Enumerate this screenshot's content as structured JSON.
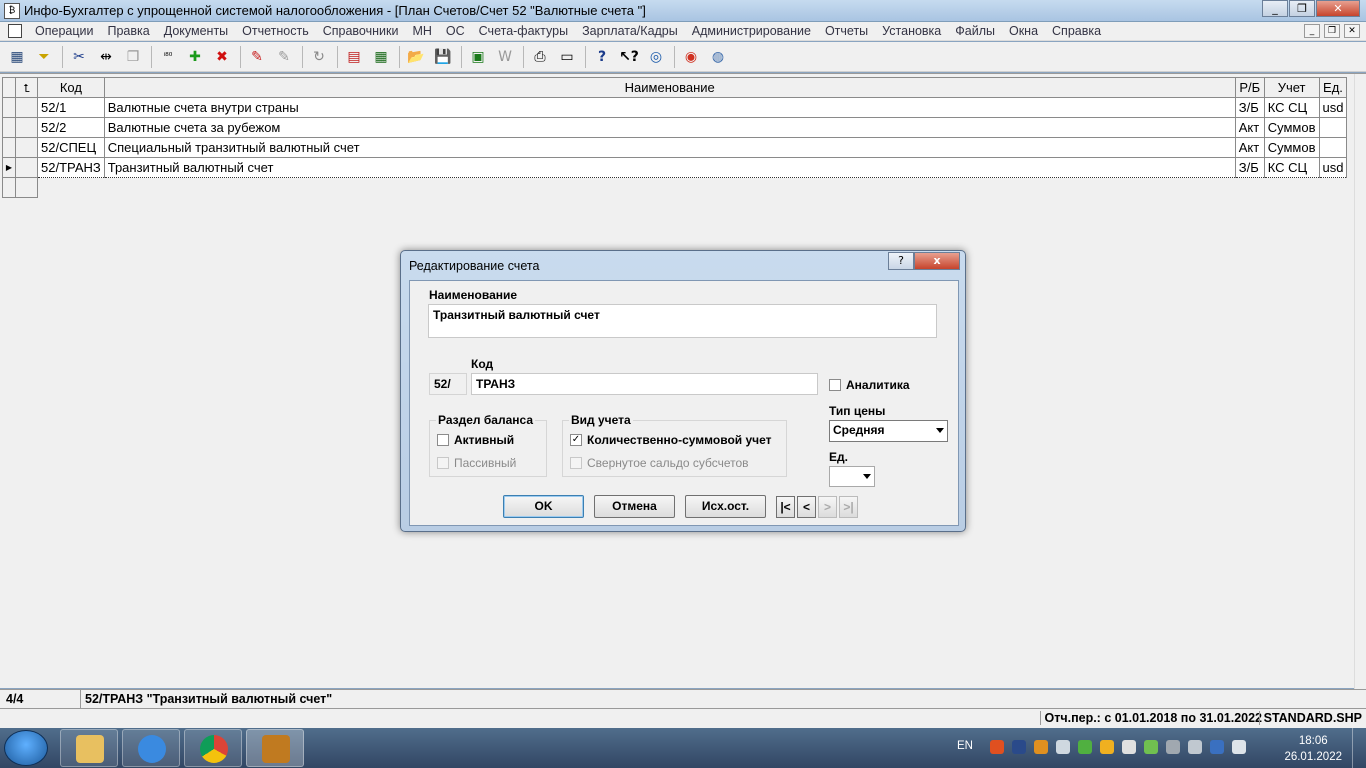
{
  "window": {
    "title": "Инфо-Бухгалтер с упрощенной системой налогообложения - [План Счетов/Счет 52 \"Валютные счета \"]"
  },
  "menu": [
    "Операции",
    "Правка",
    "Документы",
    "Отчетность",
    "Справочники",
    "МН",
    "ОС",
    "Счета-фактуры",
    "Зарплата/Кадры",
    "Администрирование",
    "Отчеты",
    "Установка",
    "Файлы",
    "Окна",
    "Справка"
  ],
  "toolbar_icons": [
    "table-icon",
    "filter-icon",
    "cut-icon",
    "split-icon",
    "copy-icon",
    "counter-icon",
    "add-icon",
    "delete-icon",
    "marker-icon",
    "unmark-icon",
    "refresh-icon",
    "document-icon",
    "calculator-icon",
    "open-folder-icon",
    "save-icon",
    "excel-icon",
    "word-icon",
    "print-icon",
    "preview-icon",
    "help-icon",
    "context-help-icon",
    "compass-icon",
    "support-icon",
    "web-icon"
  ],
  "grid": {
    "headers": {
      "code": "Код",
      "name": "Наименование",
      "rb": "Р/Б",
      "uchet": "Учет",
      "ed": "Ед."
    },
    "rows": [
      {
        "code": "52/1",
        "name": "Валютные счета внутри страны",
        "rb": "З/Б",
        "uchet": "КС СЦ",
        "ed": "usd"
      },
      {
        "code": "52/2",
        "name": "Валютные счета за рубежом",
        "rb": "Акт",
        "uchet": "Суммов",
        "ed": ""
      },
      {
        "code": "52/СПЕЦ",
        "name": "Специальный транзитный валютный счет",
        "rb": "Акт",
        "uchet": "Суммов",
        "ed": ""
      },
      {
        "code": "52/ТРАНЗ",
        "name": "Транзитный валютный счет",
        "rb": "З/Б",
        "uchet": "КС СЦ",
        "ed": "usd"
      }
    ]
  },
  "status": {
    "count": "4/4",
    "record": "52/ТРАНЗ \"Транзитный валютный счет\"",
    "period": "Отч.пер.: с 01.01.2018 по 31.01.2022",
    "file": "STANDARD.SHP"
  },
  "dialog": {
    "title": "Редактирование счета",
    "help_btn": "?",
    "close_btn": "x",
    "name_label": "Наименование",
    "name_value": "Транзитный валютный счет",
    "code_label": "Код",
    "code_prefix": "52/",
    "code_value": "ТРАНЗ",
    "analytics_label": "Аналитика",
    "balance_group": "Раздел баланса",
    "active_label": "Активный",
    "passive_label": "Пассивный",
    "uchet_group": "Вид учета",
    "qty_sum_label": "Количественно-суммовой учет",
    "folded_label": "Свернутое сальдо субсчетов",
    "price_type_label": "Тип цены",
    "price_type_value": "Средняя",
    "unit_label": "Ед.",
    "unit_value": "",
    "ok": "OK",
    "cancel": "Отмена",
    "initial": "Исх.ост.",
    "nav_first": "|<",
    "nav_prev": "<",
    "nav_next": ">",
    "nav_last": ">|",
    "states": {
      "analytics": false,
      "active": false,
      "passive": false,
      "qty_sum": true,
      "folded": false
    }
  },
  "taskbar": {
    "apps": [
      "explorer-icon",
      "ie-icon",
      "chrome-icon",
      "infobuh-icon"
    ],
    "lang": "EN",
    "time": "18:06",
    "date": "26.01.2022"
  }
}
